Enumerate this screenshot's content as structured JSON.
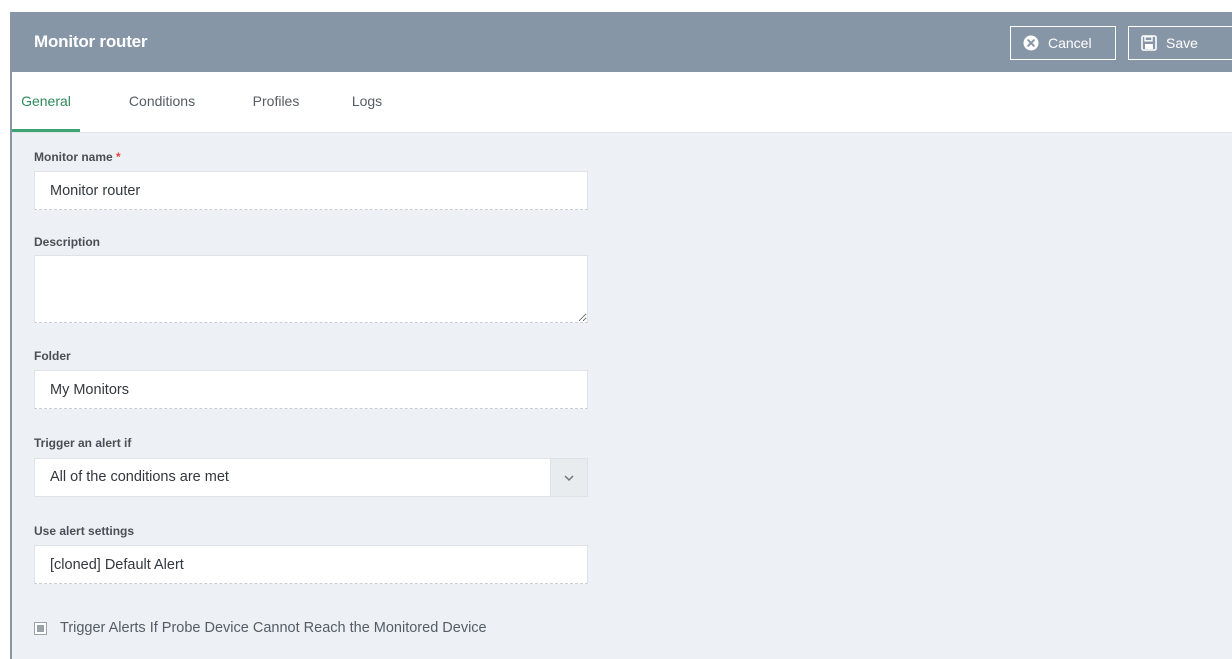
{
  "header": {
    "title": "Monitor router",
    "cancel_label": "Cancel",
    "save_label": "Save",
    "cancel_icon": "close-circle-icon",
    "save_icon": "floppy-disk-icon"
  },
  "tabs": [
    {
      "label": "General",
      "active": true
    },
    {
      "label": "Conditions",
      "active": false
    },
    {
      "label": "Profiles",
      "active": false
    },
    {
      "label": "Logs",
      "active": false
    }
  ],
  "form": {
    "monitor_name": {
      "label": "Monitor name",
      "required_mark": "*",
      "value": "Monitor router"
    },
    "description": {
      "label": "Description",
      "value": ""
    },
    "folder": {
      "label": "Folder",
      "value": "My Monitors"
    },
    "trigger": {
      "label": "Trigger an alert if",
      "value": "All of the conditions are met"
    },
    "alert_settings": {
      "label": "Use alert settings",
      "value": "[cloned] Default Alert"
    },
    "probe_checkbox": {
      "label": "Trigger Alerts If Probe Device Cannot Reach the Monitored Device",
      "checked": true
    }
  },
  "colors": {
    "header_bg": "#8796a7",
    "accent": "#3aa473",
    "content_bg": "#edf1f5"
  }
}
